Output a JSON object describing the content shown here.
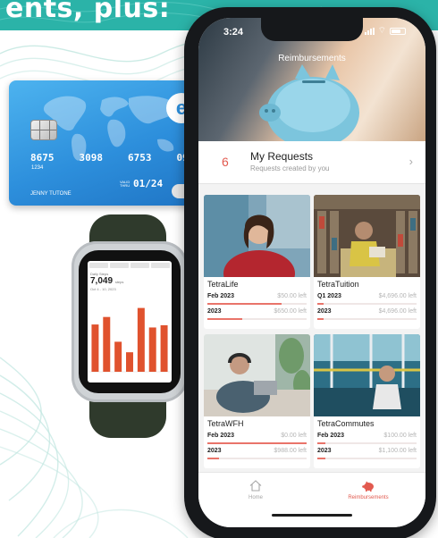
{
  "banner": {
    "text": "ents, plus:"
  },
  "side_text": {
    "top": "e",
    "bottom": "-"
  },
  "card": {
    "logo_letter": "e",
    "number_groups": [
      "8675",
      "3098",
      "6753",
      "0986"
    ],
    "small_number": "1234",
    "expiry_label": "VALID THRU",
    "expiry": "01/24",
    "holder": "JENNY TUTONE"
  },
  "watch": {
    "steps_label": "Daily Steps",
    "steps_value": "7,049",
    "steps_unit": "steps",
    "date_range": "Oct 4 - 10, 2023",
    "chart_data": {
      "type": "bar",
      "categories": [
        "1",
        "2",
        "3",
        "4",
        "5",
        "6",
        "7"
      ],
      "values": [
        63,
        73,
        40,
        26,
        85,
        59,
        62
      ],
      "ylim": [
        0,
        100
      ],
      "bar_color": "#e0522e"
    }
  },
  "status": {
    "time": "3:24"
  },
  "hero": {
    "title": "Reimbursements",
    "image": "piggy-bank"
  },
  "requests": {
    "count": "6",
    "title": "My Requests",
    "subtitle": "Requests created by you"
  },
  "programs": [
    {
      "name": "TetraLife",
      "image": "woman-red-sweater",
      "rows": [
        {
          "period": "Feb 2023",
          "left": "$50.00 left",
          "used_fraction": 0.75
        },
        {
          "period": "2023",
          "left": "$650.00 left",
          "used_fraction": 0.35
        }
      ]
    },
    {
      "name": "TetraTuition",
      "image": "student-library",
      "rows": [
        {
          "period": "Q1 2023",
          "left": "$4,696.00 left",
          "used_fraction": 0.06
        },
        {
          "period": "2023",
          "left": "$4,696.00 left",
          "used_fraction": 0.06
        }
      ]
    },
    {
      "name": "TetraWFH",
      "image": "woman-headphones-laptop",
      "rows": [
        {
          "period": "Feb 2023",
          "left": "$0.00 left",
          "used_fraction": 1.0
        },
        {
          "period": "2023",
          "left": "$988.00 left",
          "used_fraction": 0.12
        }
      ]
    },
    {
      "name": "TetraCommutes",
      "image": "man-on-bus",
      "rows": [
        {
          "period": "Feb 2023",
          "left": "$100.00 left",
          "used_fraction": 0.08
        },
        {
          "period": "2023",
          "left": "$1,100.00 left",
          "used_fraction": 0.08
        }
      ]
    }
  ],
  "tabs": {
    "home": "Home",
    "reimbursements": "Reimbursements"
  },
  "colors": {
    "accent": "#e25a4f",
    "banner": "#2bb3a8",
    "progress_track": "#efe7e6",
    "progress_fill": "#e9746a"
  }
}
